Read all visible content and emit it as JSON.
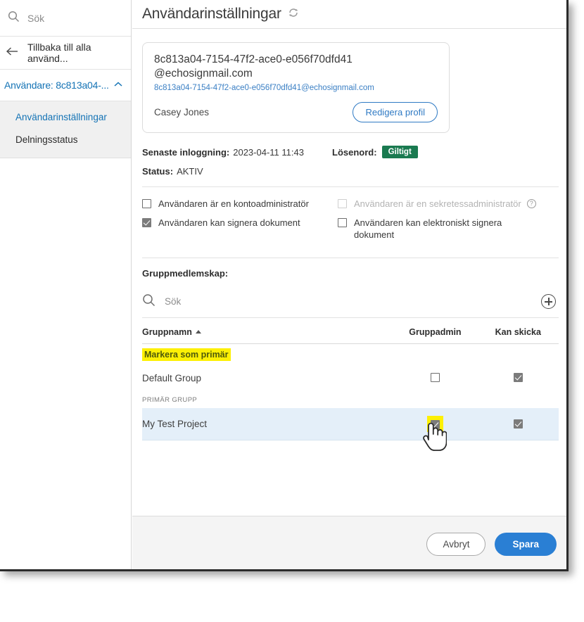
{
  "sidebar": {
    "search": {
      "icon": "search-icon",
      "placeholder": "Sök"
    },
    "back": {
      "icon": "arrow-left-icon",
      "label": "Tillbaka till alla använd..."
    },
    "group": {
      "label": "Användare: 8c813a04-...",
      "icon": "chevron-up-icon"
    },
    "sub_items": [
      {
        "label": "Användarinställningar",
        "active": true
      },
      {
        "label": "Delningsstatus",
        "active": false
      }
    ]
  },
  "main": {
    "title": "Användarinställningar",
    "title_icon": "refresh-icon",
    "user_card": {
      "uid_line1": "8c813a04-7154-47f2-ace0-e056f70dfd41",
      "uid_line2": "@echosignmail.com",
      "email": "8c813a04-7154-47f2-ace0-e056f70dfd41@echosignmail.com",
      "name": "Casey Jones",
      "edit_button": "Redigera profil"
    },
    "info": {
      "last_login_label": "Senaste inloggning:",
      "last_login_value": "2023-04-11 11:43",
      "password_label": "Lösenord:",
      "password_badge": "Giltigt",
      "status_label": "Status:",
      "status_value": "AKTIV"
    },
    "permissions": [
      {
        "label": "Användaren är en kontoadministratör",
        "checked": false,
        "disabled": false,
        "help": false
      },
      {
        "label": "Användaren kan signera dokument",
        "checked": true,
        "disabled": false,
        "help": false
      },
      {
        "label": "Användaren är en sekretessadministratör",
        "checked": false,
        "disabled": true,
        "help": true
      },
      {
        "label": "Användaren kan elektroniskt signera dokument",
        "checked": false,
        "disabled": false,
        "help": false
      }
    ],
    "groups": {
      "title": "Gruppmedlemskap:",
      "search_placeholder": "Sök",
      "search_icon": "search-icon",
      "add_icon": "plus-circle-icon",
      "columns": [
        "Gruppnamn",
        "Gruppadmin",
        "Kan skicka"
      ],
      "sort_column": "Gruppnamn",
      "sort_direction": "asc",
      "mark_primary_link": "Markera som primär",
      "primary_tag": "PRIMÄR GRUPP",
      "rows": [
        {
          "name": "Default Group",
          "admin": false,
          "can_send": true,
          "is_primary": false,
          "admin_highlight": false
        },
        {
          "name": "My Test Project",
          "admin": true,
          "can_send": true,
          "is_primary": true,
          "admin_highlight": true
        }
      ]
    }
  },
  "footer": {
    "cancel": "Avbryt",
    "save": "Spara"
  },
  "colors": {
    "accent_blue": "#2a7fd4",
    "link_blue": "#1473b5",
    "badge_green": "#1a7a50",
    "highlight_yellow": "#fdf005",
    "primary_row_blue": "#e4eff9"
  }
}
